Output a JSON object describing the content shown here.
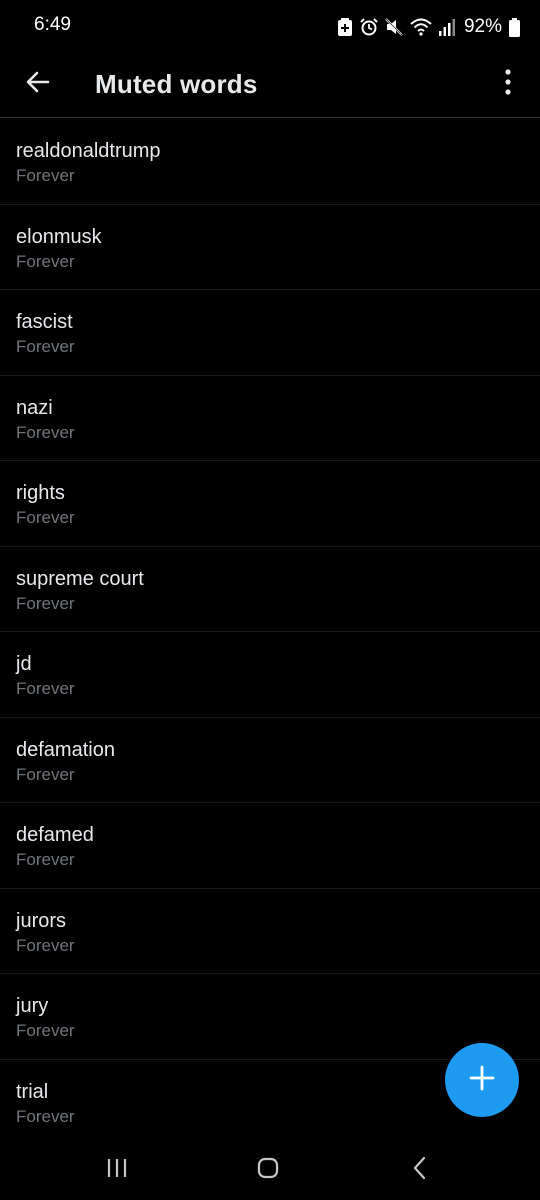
{
  "status_bar": {
    "time": "6:49",
    "battery_percent": "92%",
    "icons": [
      "battery-saver-icon",
      "alarm-icon",
      "mute-icon",
      "wifi-icon",
      "signal-icon",
      "battery-icon"
    ]
  },
  "header": {
    "title": "Muted words",
    "back_icon": "arrow-left-icon",
    "menu_icon": "more-vertical-icon"
  },
  "muted_words": [
    {
      "word": "realdonaldtrump",
      "duration": "Forever"
    },
    {
      "word": "elonmusk",
      "duration": "Forever"
    },
    {
      "word": "fascist",
      "duration": "Forever"
    },
    {
      "word": "nazi",
      "duration": "Forever"
    },
    {
      "word": "rights",
      "duration": "Forever"
    },
    {
      "word": "supreme court",
      "duration": "Forever"
    },
    {
      "word": "jd",
      "duration": "Forever"
    },
    {
      "word": "defamation",
      "duration": "Forever"
    },
    {
      "word": "defamed",
      "duration": "Forever"
    },
    {
      "word": "jurors",
      "duration": "Forever"
    },
    {
      "word": "jury",
      "duration": "Forever"
    },
    {
      "word": "trial",
      "duration": "Forever"
    }
  ],
  "fab": {
    "icon": "plus-icon"
  },
  "colors": {
    "background": "#000000",
    "text_primary": "#e7e9ea",
    "text_secondary": "#71767b",
    "accent": "#1d9bf0",
    "divider": "#2f3336"
  }
}
